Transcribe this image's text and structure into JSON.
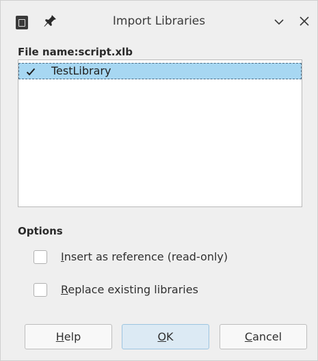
{
  "window": {
    "title": "Import Libraries"
  },
  "file_label": "File name:script.xlb",
  "libraries": [
    {
      "label": "TestLibrary",
      "checked": true,
      "selected": true
    }
  ],
  "options": {
    "heading": "Options",
    "insert_reference": {
      "mnemonic": "I",
      "rest": "nsert as reference (read-only)",
      "checked": false
    },
    "replace_existing": {
      "mnemonic": "R",
      "rest": "eplace existing libraries",
      "checked": false
    }
  },
  "buttons": {
    "help": {
      "mnemonic": "H",
      "rest": "elp"
    },
    "ok": {
      "mnemonic": "O",
      "rest": "K"
    },
    "cancel": {
      "mnemonic": "C",
      "rest": "ancel"
    }
  },
  "colors": {
    "selection": "#a7d7f2",
    "default_button": "#dceaf4",
    "window_bg": "#efefef"
  },
  "icons": {
    "app": "document-icon",
    "pin": "pin-icon",
    "minimize": "chevron-down-icon",
    "close": "close-icon",
    "check": "checkmark-icon"
  }
}
